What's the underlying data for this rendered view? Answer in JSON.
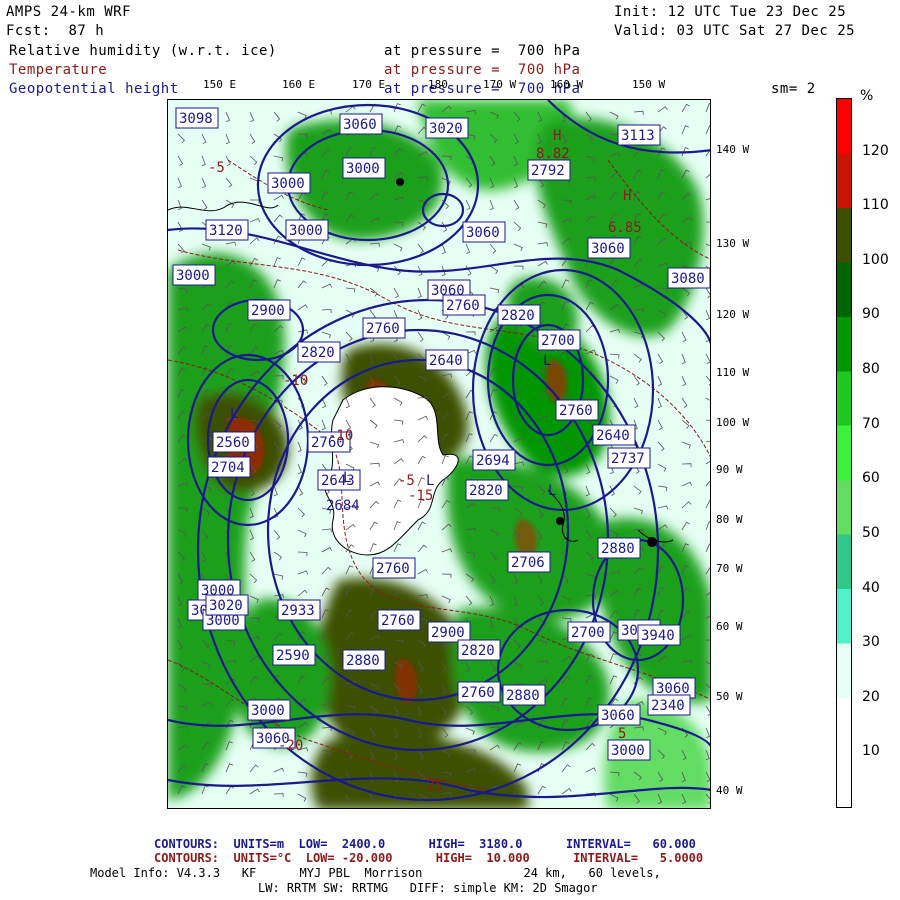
{
  "header": {
    "model": "AMPS 24-km WRF",
    "init": "Init: 12 UTC Tue 23 Dec 25",
    "fcst": "Fcst:  87 h",
    "valid": "Valid: 03 UTC Sat 27 Dec 25",
    "fields": [
      {
        "name": "Relative humidity (w.r.t. ice)",
        "level": "at pressure =  700 hPa",
        "color": "#000000"
      },
      {
        "name": "Temperature",
        "level": "at pressure =  700 hPa",
        "color": "#8b1a1a"
      },
      {
        "name": "Geopotential height",
        "level": "at pressure =  700 hPa",
        "color": "#1a1a8c"
      }
    ],
    "smoothing": "sm= 2"
  },
  "longitude_labels": [
    "150 E",
    "160 E",
    "170 E",
    "180",
    "170 W",
    "160 W",
    "150 W"
  ],
  "latitude_labels": [
    "140 W",
    "130 W",
    "120 W",
    "110 W",
    "100 W",
    "90 W",
    "80 W",
    "70 W",
    "60 W",
    "50 W",
    "40 W"
  ],
  "colorbar": {
    "unit": "%",
    "ticks": [
      "120",
      "110",
      "100",
      "90",
      "80",
      "70",
      "60",
      "50",
      "40",
      "30",
      "20",
      "10"
    ],
    "colors": [
      "#ff0000",
      "#c81400",
      "#3c5000",
      "#006400",
      "#009600",
      "#1ec81e",
      "#3cf03c",
      "#64dc64",
      "#2ec88c",
      "#50f0c8",
      "#e6fff5",
      "#ffffff",
      "#ffffff"
    ]
  },
  "contour_labels": {
    "height": [
      "3098",
      "3060",
      "3020",
      "3000",
      "3000",
      "3060",
      "3120",
      "3000",
      "3000",
      "3060",
      "3060",
      "2900",
      "2820",
      "2760",
      "2760",
      "2820",
      "2640",
      "2700",
      "2760",
      "2640",
      "2694",
      "2560",
      "2760",
      "2737",
      "2704",
      "2643",
      "2760",
      "2820",
      "2760",
      "2880",
      "2900",
      "2706",
      "2700",
      "2820",
      "2880",
      "2590",
      "2760",
      "2880",
      "2880",
      "3000",
      "3060",
      "3000",
      "3050",
      "3060",
      "3000",
      "3060",
      "3000",
      "3020",
      "2792",
      "3940",
      "3060",
      "2340",
      "3113",
      "3080",
      "2933"
    ],
    "temperature": [
      "-5",
      "-10",
      "-15",
      "-20",
      "-25",
      "5",
      "-5",
      "-10"
    ],
    "highs_lows": [
      "L",
      "L",
      "L",
      "L",
      "L",
      "H",
      "H"
    ],
    "extremes": [
      "8.82",
      "6.85",
      "2684"
    ]
  },
  "footer": {
    "line1": {
      "label": "CONTOURS:",
      "units": "UNITS=m",
      "low": "LOW=  2400.0",
      "high": "HIGH=  3180.0",
      "interval": "INTERVAL=   60.000",
      "color": "#1a1a8c"
    },
    "line2": {
      "label": "CONTOURS:",
      "units": "UNITS=°C",
      "low": "LOW= -20.000",
      "high": "HIGH=  10.000",
      "interval": "INTERVAL=   5.0000",
      "color": "#8b1a1a"
    },
    "line3": "Model Info: V4.3.3   KF      MYJ PBL  Morrison              24 km,   60 levels,",
    "line4": "LW: RRTM SW: RRTMG   DIFF: simple KM: 2D Smagor"
  }
}
